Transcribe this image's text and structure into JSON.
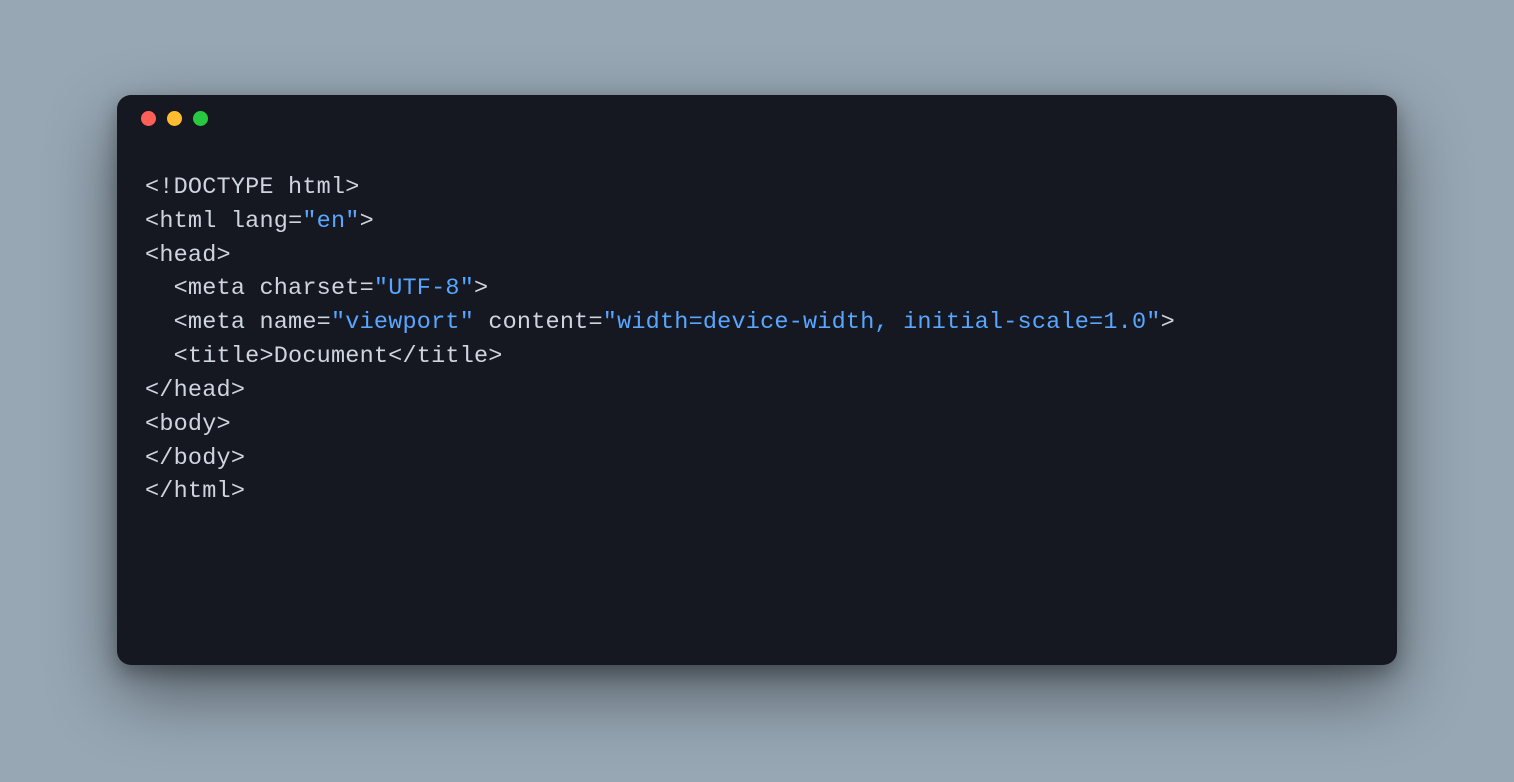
{
  "code": {
    "lines": [
      [
        {
          "cls": "p",
          "text": "<!"
        },
        {
          "cls": "t",
          "text": "DOCTYPE html"
        },
        {
          "cls": "p",
          "text": ">"
        }
      ],
      [
        {
          "cls": "p",
          "text": "<"
        },
        {
          "cls": "t",
          "text": "html"
        },
        {
          "cls": "p",
          "text": " "
        },
        {
          "cls": "a",
          "text": "lang"
        },
        {
          "cls": "p",
          "text": "="
        },
        {
          "cls": "s",
          "text": "\"en\""
        },
        {
          "cls": "p",
          "text": ">"
        }
      ],
      [
        {
          "cls": "p",
          "text": "<"
        },
        {
          "cls": "t",
          "text": "head"
        },
        {
          "cls": "p",
          "text": ">"
        }
      ],
      [
        {
          "cls": "p",
          "text": "  <"
        },
        {
          "cls": "t",
          "text": "meta"
        },
        {
          "cls": "p",
          "text": " "
        },
        {
          "cls": "a",
          "text": "charset"
        },
        {
          "cls": "p",
          "text": "="
        },
        {
          "cls": "s",
          "text": "\"UTF-8\""
        },
        {
          "cls": "p",
          "text": ">"
        }
      ],
      [
        {
          "cls": "p",
          "text": "  <"
        },
        {
          "cls": "t",
          "text": "meta"
        },
        {
          "cls": "p",
          "text": " "
        },
        {
          "cls": "a",
          "text": "name"
        },
        {
          "cls": "p",
          "text": "="
        },
        {
          "cls": "s",
          "text": "\"viewport\""
        },
        {
          "cls": "p",
          "text": " "
        },
        {
          "cls": "a",
          "text": "content"
        },
        {
          "cls": "p",
          "text": "="
        },
        {
          "cls": "s",
          "text": "\"width=device-width, initial-scale=1.0\""
        },
        {
          "cls": "p",
          "text": ">"
        }
      ],
      [
        {
          "cls": "p",
          "text": "  <"
        },
        {
          "cls": "t",
          "text": "title"
        },
        {
          "cls": "p",
          "text": ">"
        },
        {
          "cls": "tx",
          "text": "Document"
        },
        {
          "cls": "p",
          "text": "</"
        },
        {
          "cls": "t",
          "text": "title"
        },
        {
          "cls": "p",
          "text": ">"
        }
      ],
      [
        {
          "cls": "p",
          "text": "</"
        },
        {
          "cls": "t",
          "text": "head"
        },
        {
          "cls": "p",
          "text": ">"
        }
      ],
      [
        {
          "cls": "p",
          "text": "<"
        },
        {
          "cls": "t",
          "text": "body"
        },
        {
          "cls": "p",
          "text": ">"
        }
      ],
      [
        {
          "cls": "p",
          "text": "</"
        },
        {
          "cls": "t",
          "text": "body"
        },
        {
          "cls": "p",
          "text": ">"
        }
      ],
      [
        {
          "cls": "p",
          "text": "</"
        },
        {
          "cls": "t",
          "text": "html"
        },
        {
          "cls": "p",
          "text": ">"
        }
      ]
    ]
  },
  "colors": {
    "background_page": "#97a7b4",
    "background_window": "#151821",
    "string": "#58a6ff",
    "default_text": "#cfd5df",
    "traffic_red": "#ff5f57",
    "traffic_yellow": "#febc2e",
    "traffic_green": "#28c840"
  }
}
